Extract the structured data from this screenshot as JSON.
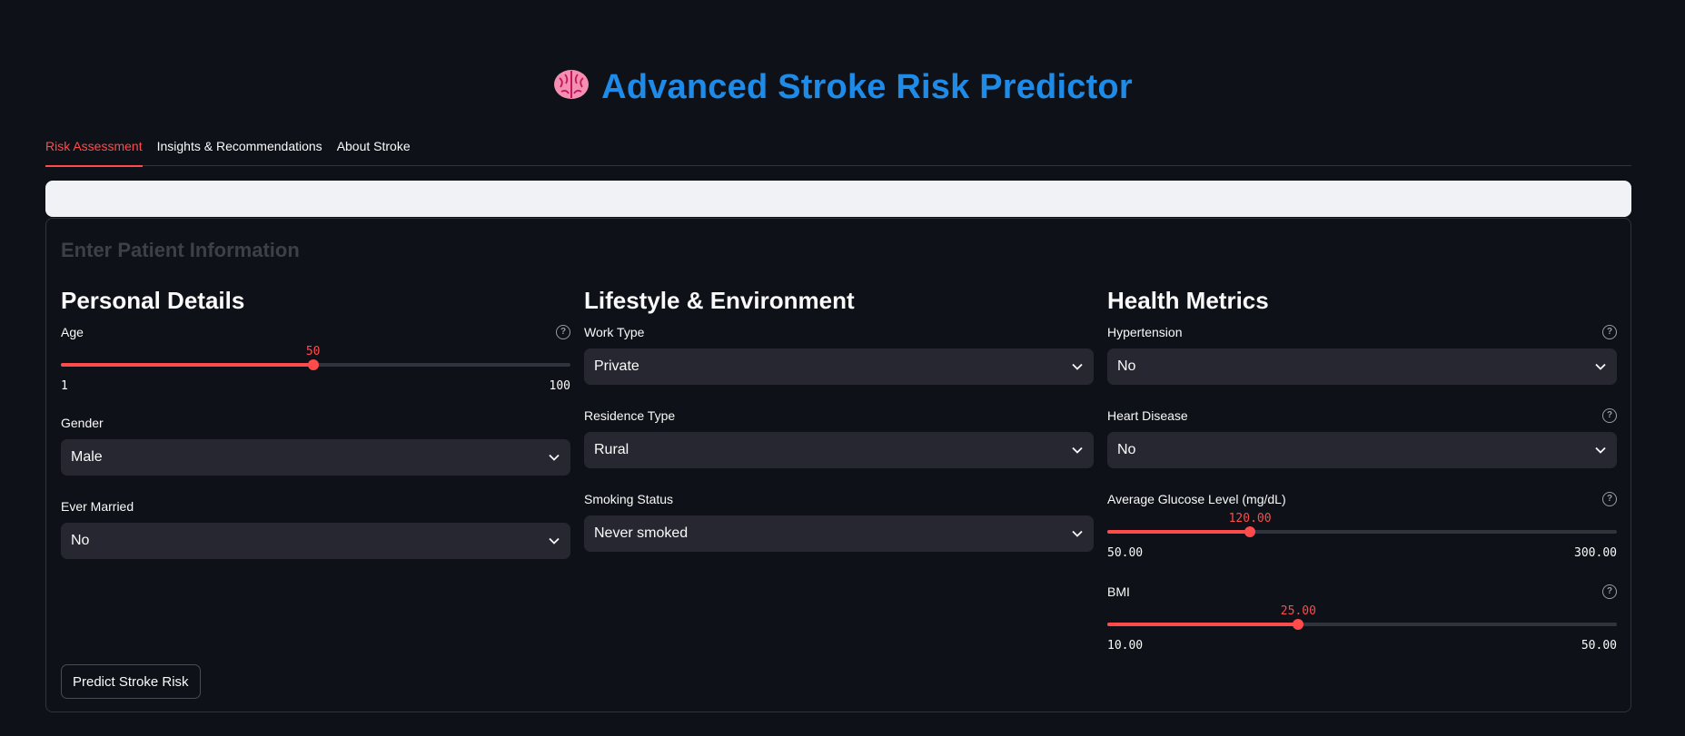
{
  "app": {
    "title": "Advanced Stroke Risk Predictor",
    "title_icon": "brain-icon",
    "accent_color": "#ff4b4b",
    "title_color": "#1f8be8"
  },
  "tabs": [
    {
      "label": "Risk Assessment",
      "active": true
    },
    {
      "label": "Insights & Recommendations",
      "active": false
    },
    {
      "label": "About Stroke",
      "active": false
    }
  ],
  "form": {
    "heading": "Enter Patient Information",
    "submit_label": "Predict Stroke Risk",
    "personal": {
      "heading": "Personal Details",
      "age": {
        "label": "Age",
        "value": "50",
        "min": "1",
        "max": "100",
        "fraction": 0.495
      },
      "gender": {
        "label": "Gender",
        "value": "Male"
      },
      "married": {
        "label": "Ever Married",
        "value": "No"
      }
    },
    "lifestyle": {
      "heading": "Lifestyle & Environment",
      "work": {
        "label": "Work Type",
        "value": "Private"
      },
      "residence": {
        "label": "Residence Type",
        "value": "Rural"
      },
      "smoking": {
        "label": "Smoking Status",
        "value": "Never smoked"
      }
    },
    "health": {
      "heading": "Health Metrics",
      "hypertension": {
        "label": "Hypertension",
        "value": "No"
      },
      "heart": {
        "label": "Heart Disease",
        "value": "No"
      },
      "glucose": {
        "label": "Average Glucose Level (mg/dL)",
        "value": "120.00",
        "min": "50.00",
        "max": "300.00",
        "fraction": 0.28
      },
      "bmi": {
        "label": "BMI",
        "value": "25.00",
        "min": "10.00",
        "max": "50.00",
        "fraction": 0.375
      }
    }
  }
}
